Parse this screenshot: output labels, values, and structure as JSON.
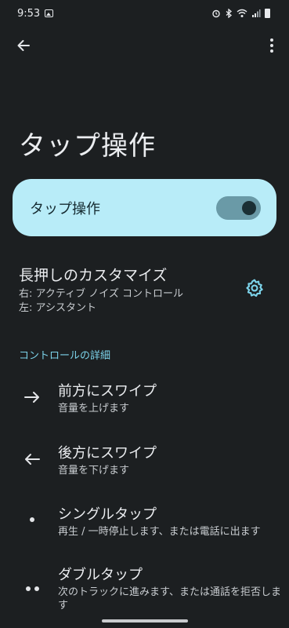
{
  "status_bar": {
    "time": "9:53",
    "left_icons": [
      "gallery-icon"
    ],
    "right_icons": [
      "alarm-icon",
      "bluetooth-icon",
      "wifi-icon",
      "signal-icon",
      "battery-icon"
    ]
  },
  "app_bar": {
    "back_icon": "arrow-left-icon",
    "more_icon": "more-vertical-icon"
  },
  "page": {
    "title": "タップ操作"
  },
  "main_toggle": {
    "label": "タップ操作",
    "enabled": true,
    "card_color": "#b8ecf8"
  },
  "longpress": {
    "title": "長押しのカスタマイズ",
    "right_line": "右: アクティブ ノイズ コントロール",
    "left_line": "左: アシスタント",
    "icon": "gear-icon",
    "icon_color": "#7cd3ea"
  },
  "section": {
    "header": "コントロールの詳細"
  },
  "controls": [
    {
      "icon": "arrow-right-icon",
      "title": "前方にスワイプ",
      "subtitle": "音量を上げます"
    },
    {
      "icon": "arrow-left-icon",
      "title": "後方にスワイプ",
      "subtitle": "音量を下げます"
    },
    {
      "icon": "single-dot-icon",
      "title": "シングルタップ",
      "subtitle": "再生 / 一時停止します、または電話に出ます"
    },
    {
      "icon": "double-dot-icon",
      "title": "ダブルタップ",
      "subtitle": "次のトラックに進みます、または通話を拒否します"
    }
  ],
  "colors": {
    "background": "#1c1f21",
    "accent": "#7cd3ea"
  }
}
